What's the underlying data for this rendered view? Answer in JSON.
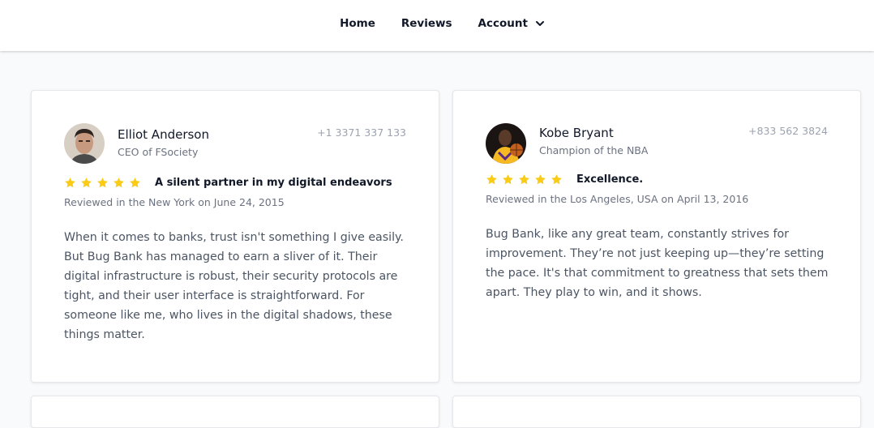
{
  "nav": {
    "home": "Home",
    "reviews": "Reviews",
    "account": "Account"
  },
  "reviews": [
    {
      "name": "Elliot Anderson",
      "role": "CEO of FSociety",
      "phone": "+1 3371 337 133",
      "rating": 5,
      "headline": "A silent partner in my digital endeavors",
      "reviewed": "Reviewed in the New York on June 24, 2015",
      "body": "When it comes to banks, trust isn't something I give easily. But Bug Bank has managed to earn a sliver of it. Their digital infrastructure is robust, their security protocols are tight, and their user interface is straightforward. For someone like me, who lives in the digital shadows, these things matter."
    },
    {
      "name": "Kobe Bryant",
      "role": "Champion of the NBA",
      "phone": "+833 562 3824",
      "rating": 5,
      "headline": "Excellence.",
      "reviewed": "Reviewed in the Los Angeles, USA on April 13, 2016",
      "body": "Bug Bank, like any great team, constantly strives for improvement. They’re not just keeping up—they’re setting the pace. It's that commitment to greatness that sets them apart. They play to win, and it shows."
    }
  ],
  "colors": {
    "star": "#facc15",
    "background": "#f9fafb",
    "card": "#ffffff"
  },
  "icons": {
    "dropdown": "chevron-down-icon",
    "rating": "star-icon"
  }
}
